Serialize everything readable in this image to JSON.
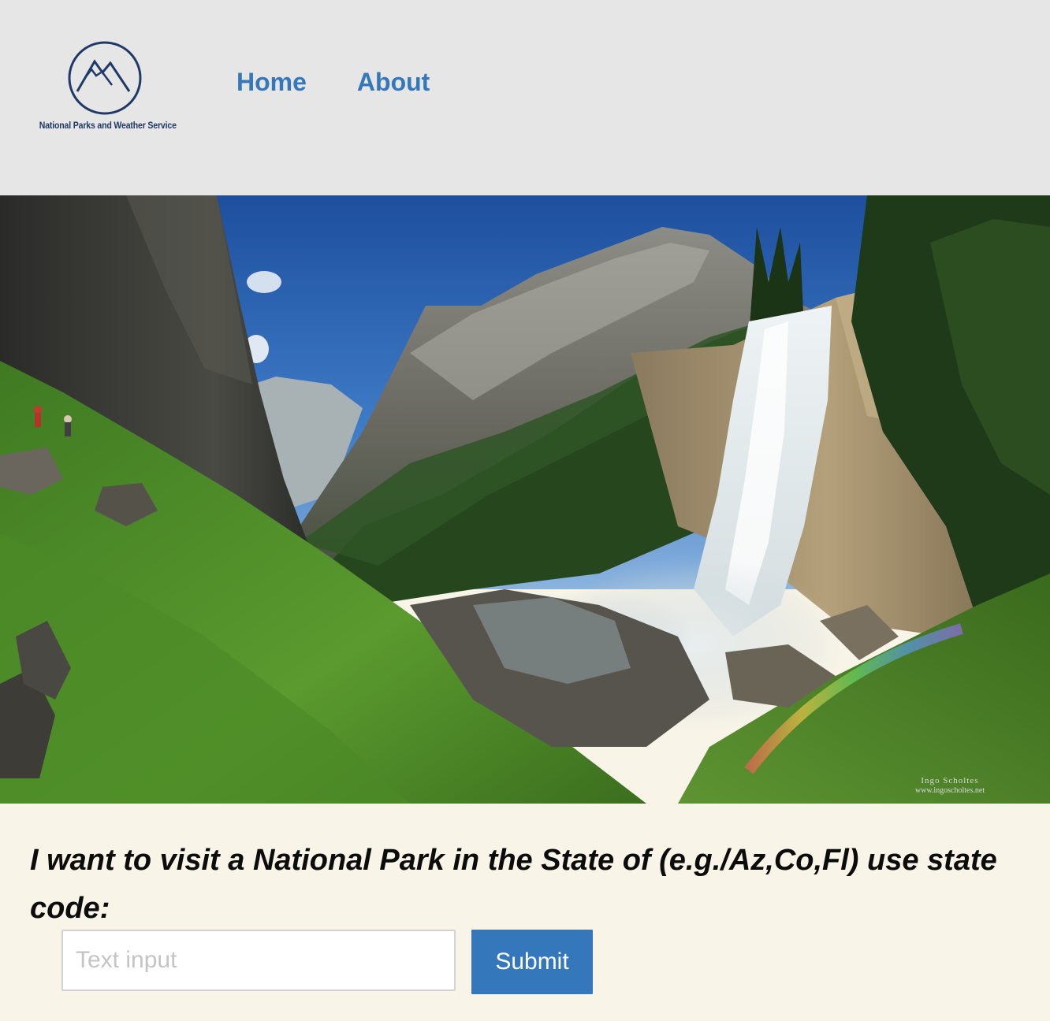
{
  "header": {
    "logo_text": "National Parks and Weather Service",
    "nav": {
      "home_label": "Home",
      "about_label": "About"
    }
  },
  "hero": {
    "watermark_line1": "Ingo Scholtes",
    "watermark_line2": "www.ingoscholtes.net"
  },
  "form": {
    "prompt": "I want to visit a National Park in the State of (e.g./Az,Co,Fl) use state code:",
    "input_placeholder": "Text input",
    "input_value": "",
    "submit_label": "Submit"
  },
  "colors": {
    "header_bg": "#e6e6e6",
    "nav_link": "#3477bb",
    "page_bg": "#f8f4e7",
    "button_bg": "#3477bb",
    "logo": "#1f3a66"
  }
}
